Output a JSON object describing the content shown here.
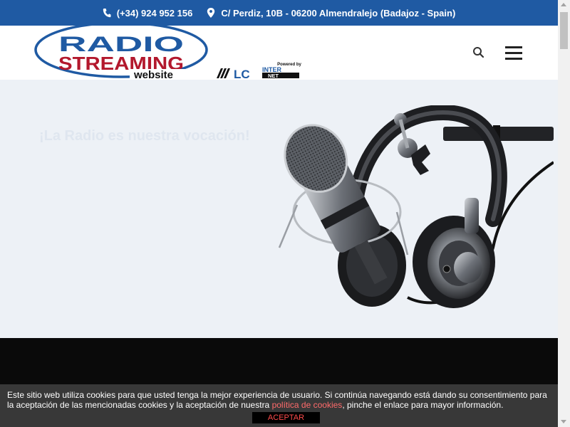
{
  "topbar": {
    "phone": "(+34) 924 952 156",
    "address": "C/ Perdiz, 10B - 06200 Almendralejo (Badajoz - Spain)",
    "phone_icon": "phone-icon",
    "address_icon": "map-pin-icon"
  },
  "header": {
    "logo": {
      "line1": "RADIO",
      "line2": "STREAMING",
      "line3": "website"
    },
    "powered": {
      "label": "Powered by",
      "brand_lc": "LC",
      "brand_inter": "INTER",
      "brand_net": "NET"
    },
    "search_icon": "search-icon",
    "menu_icon": "hamburger-menu-icon"
  },
  "hero": {
    "title": "¡La Radio es nuestra vocación!",
    "image": "microphone-headphones-image"
  },
  "cookie": {
    "text_before": "Este sitio web utiliza cookies para que usted tenga la mejor experiencia de usuario. Si continúa navegando está dando su consentimiento para la aceptación de las mencionadas cookies y la aceptación de nuestra ",
    "link": "política de cookies",
    "text_after": ", pinche el enlace para mayor información.",
    "accept": "ACEPTAR"
  },
  "colors": {
    "topbar": "#1f5aa3",
    "logo_blue": "#1f5aa3",
    "logo_red": "#b3182d",
    "hero_bg": "#edf1f6",
    "cookie_link": "#ff6b6b"
  }
}
